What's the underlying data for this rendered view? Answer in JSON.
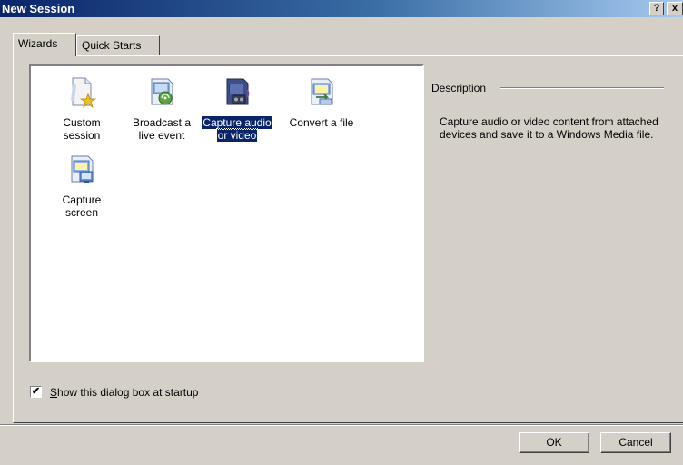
{
  "window": {
    "title": "New Session",
    "help_label": "?",
    "close_label": "x"
  },
  "tabs": [
    {
      "label": "Wizards",
      "active": true
    },
    {
      "label": "Quick Starts",
      "active": false
    }
  ],
  "wizards": [
    {
      "label_line1": "Custom",
      "label_line2": "session",
      "icon": "custom-session-icon",
      "selected": false
    },
    {
      "label_line1": "Broadcast a",
      "label_line2": "live event",
      "icon": "broadcast-icon",
      "selected": false
    },
    {
      "label_line1": "Capture audio",
      "label_line2": "or video",
      "icon": "capture-audio-video-icon",
      "selected": true
    },
    {
      "label_line1": "Convert a file",
      "label_line2": "",
      "icon": "convert-file-icon",
      "selected": false
    },
    {
      "label_line1": "Capture",
      "label_line2": "screen",
      "icon": "capture-screen-icon",
      "selected": false
    }
  ],
  "description": {
    "heading": "Description",
    "text": "Capture audio or video content from attached devices and save it to a Windows Media file."
  },
  "startup_checkbox": {
    "checked": true,
    "label_underlined": "S",
    "label_rest": "how this dialog box at startup",
    "check_mark": "✔"
  },
  "buttons": {
    "ok": "OK",
    "cancel": "Cancel"
  },
  "colors": {
    "titlebar_start": "#0a246a",
    "titlebar_end": "#a6caf0",
    "face": "#d4d0c8",
    "selection": "#0a246a"
  }
}
